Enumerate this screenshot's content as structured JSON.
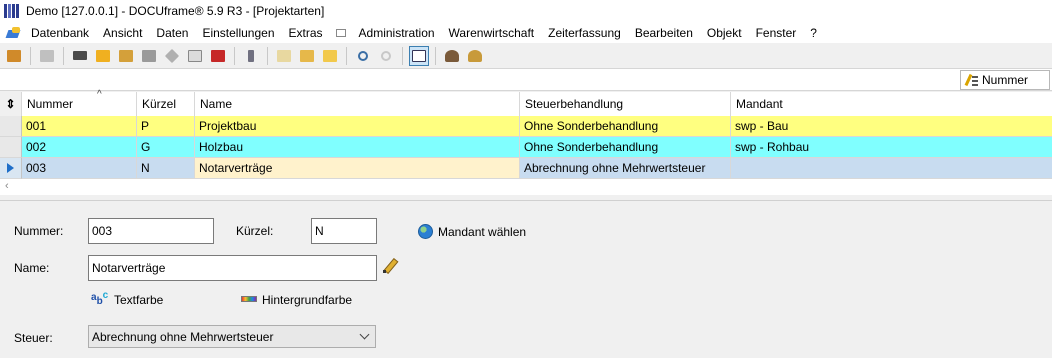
{
  "window": {
    "title": "Demo [127.0.0.1] - DOCUframe® 5.9 R3 - [Projektarten]"
  },
  "menu": {
    "items": [
      "Datenbank",
      "Ansicht",
      "Daten",
      "Einstellungen",
      "Extras",
      "",
      "Administration",
      "Warenwirtschaft",
      "Zeiterfassung",
      "Bearbeiten",
      "Objekt",
      "Fenster",
      "?"
    ]
  },
  "sortbar": {
    "label": "Nummer"
  },
  "grid": {
    "columns": [
      "Nummer",
      "Kürzel",
      "Name",
      "Steuerbehandlung",
      "Mandant"
    ],
    "rows": [
      {
        "nummer": "001",
        "kuerzel": "P",
        "name": "Projektbau",
        "steuer": "Ohne Sonderbehandlung",
        "mandant": "swp - Bau",
        "bg": "#ffff80"
      },
      {
        "nummer": "002",
        "kuerzel": "G",
        "name": "Holzbau",
        "steuer": "Ohne Sonderbehandlung",
        "mandant": "swp - Rohbau",
        "bg": "#80ffff"
      },
      {
        "nummer": "003",
        "kuerzel": "N",
        "name": "Notarverträge",
        "steuer": "Abrechnung ohne Mehrwertsteuer",
        "mandant": "",
        "bg": "#c8dcf0",
        "current": true
      }
    ]
  },
  "detail": {
    "nummer_label": "Nummer:",
    "nummer_value": "003",
    "kuerzel_label": "Kürzel:",
    "kuerzel_value": "N",
    "mandant_label": "Mandant wählen",
    "name_label": "Name:",
    "name_value": "Notarverträge",
    "textfarbe_label": "Textfarbe",
    "hintergrund_label": "Hintergrundfarbe",
    "steuer_label": "Steuer:",
    "steuer_value": "Abrechnung ohne Mehrwertsteuer"
  },
  "colors": {
    "row_yellow": "#ffff80",
    "row_cyan": "#80ffff",
    "row_selected": "#c8dcf0",
    "name_edit_bg": "#fff2cc"
  }
}
